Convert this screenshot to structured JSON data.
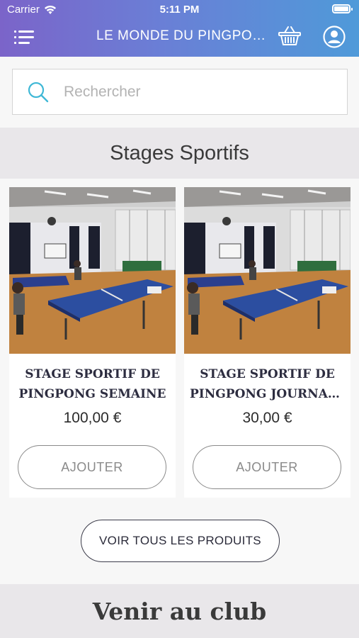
{
  "status_bar": {
    "carrier": "Carrier",
    "time": "5:11 PM"
  },
  "header": {
    "title": "LE MONDE DU PINGPONG",
    "icons": [
      "menu-icon",
      "basket-icon",
      "user-icon"
    ],
    "gradient_colors": [
      "#7b64c9",
      "#4f9ad9"
    ]
  },
  "search": {
    "placeholder": "Rechercher",
    "value": ""
  },
  "section": {
    "title": "Stages Sportifs"
  },
  "products": [
    {
      "name_line1": "STAGE SPORTIF DE",
      "name_line2": "PINGPONG SEMAINE",
      "price": "100,00 €",
      "add_label": "AJOUTER"
    },
    {
      "name_line1": "STAGE SPORTIF DE",
      "name_line2": "PINGPONG JOURNALIER",
      "price": "30,00 €",
      "add_label": "AJOUTER"
    }
  ],
  "view_all_label": "VOIR TOUS LES PRODUITS",
  "next_section": {
    "title": "Venir au club"
  }
}
